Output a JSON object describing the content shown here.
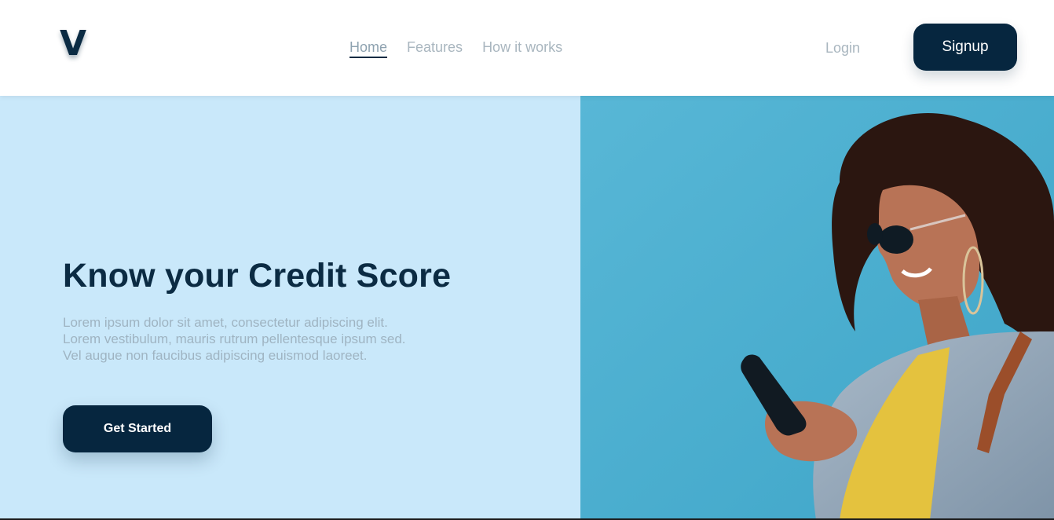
{
  "brand": {
    "logo_letter": "V"
  },
  "nav": {
    "items": [
      {
        "label": "Home",
        "active": true
      },
      {
        "label": "Features",
        "active": false
      },
      {
        "label": "How it works",
        "active": false
      }
    ],
    "login_label": "Login",
    "signup_label": "Signup"
  },
  "hero": {
    "title": "Know your Credit Score",
    "description": "Lorem ipsum dolor sit amet, consectetur adipiscing elit. Lorem vestibulum, mauris rutrum pellentesque ipsum sed. Vel augue non faucibus adipiscing euismod laoreet.",
    "cta_label": "Get Started"
  },
  "colors": {
    "primary": "#06263f",
    "hero_background": "#c9e8fa",
    "photo_background": "#4fb1d1",
    "nav_text": "#a9b6bf"
  }
}
